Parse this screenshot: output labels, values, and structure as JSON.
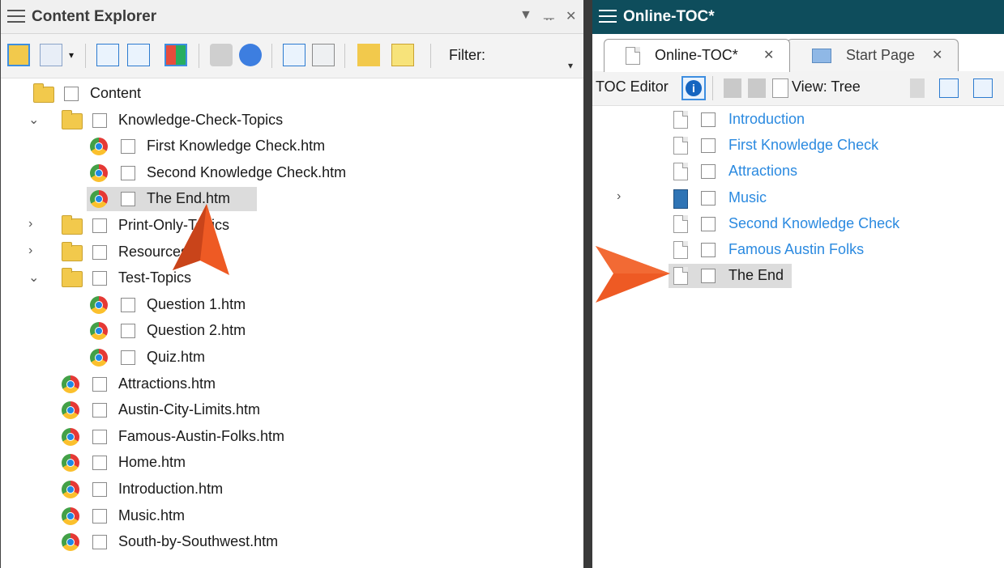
{
  "left": {
    "title": "Content Explorer",
    "window_controls": {
      "dropdown": "▼",
      "pin": "ᅲ",
      "close": "✕"
    },
    "filter_label": "Filter:",
    "tree": [
      {
        "label": "Content",
        "icon": "folder-open-icon",
        "level": 0,
        "chevron": ""
      },
      {
        "label": "Knowledge-Check-Topics",
        "icon": "folder-open-icon",
        "level": 1,
        "chevron": "⌄"
      },
      {
        "label": "First Knowledge Check.htm",
        "icon": "chrome-icon",
        "level": 2,
        "chevron": ""
      },
      {
        "label": "Second Knowledge Check.htm",
        "icon": "chrome-icon",
        "level": 2,
        "chevron": ""
      },
      {
        "label": "The End.htm",
        "icon": "chrome-icon",
        "level": 2,
        "chevron": "",
        "selected": true
      },
      {
        "label": "Print-Only-Topics",
        "icon": "folder-icon",
        "level": 1,
        "chevron": "›"
      },
      {
        "label": "Resources",
        "icon": "folder-icon",
        "level": 1,
        "chevron": "›"
      },
      {
        "label": "Test-Topics",
        "icon": "folder-open-icon",
        "level": 1,
        "chevron": "⌄"
      },
      {
        "label": "Question 1.htm",
        "icon": "chrome-icon",
        "level": 2,
        "chevron": ""
      },
      {
        "label": "Question 2.htm",
        "icon": "chrome-icon",
        "level": 2,
        "chevron": ""
      },
      {
        "label": "Quiz.htm",
        "icon": "chrome-icon",
        "level": 2,
        "chevron": ""
      },
      {
        "label": "Attractions.htm",
        "icon": "chrome-icon",
        "level": 1,
        "chevron": ""
      },
      {
        "label": "Austin-City-Limits.htm",
        "icon": "chrome-icon",
        "level": 1,
        "chevron": ""
      },
      {
        "label": "Famous-Austin-Folks.htm",
        "icon": "chrome-icon",
        "level": 1,
        "chevron": ""
      },
      {
        "label": "Home.htm",
        "icon": "chrome-icon",
        "level": 1,
        "chevron": ""
      },
      {
        "label": "Introduction.htm",
        "icon": "chrome-icon",
        "level": 1,
        "chevron": ""
      },
      {
        "label": "Music.htm",
        "icon": "chrome-icon",
        "level": 1,
        "chevron": ""
      },
      {
        "label": "South-by-Southwest.htm",
        "icon": "chrome-icon",
        "level": 1,
        "chevron": ""
      }
    ]
  },
  "right": {
    "title": "Online-TOC*",
    "tabs": [
      {
        "label": "Online-TOC*",
        "close": "✕",
        "active": true
      },
      {
        "label": "Start Page",
        "close": "✕",
        "active": false
      }
    ],
    "toolbar": {
      "editor_label": "TOC Editor",
      "view_label": "View: Tree"
    },
    "toc": [
      {
        "label": "Introduction",
        "icon": "page-icon",
        "link": true,
        "chevron": ""
      },
      {
        "label": "First Knowledge Check",
        "icon": "page-icon",
        "link": true,
        "chevron": ""
      },
      {
        "label": "Attractions",
        "icon": "page-icon",
        "link": true,
        "chevron": ""
      },
      {
        "label": "Music",
        "icon": "book-icon",
        "link": true,
        "chevron": "›"
      },
      {
        "label": "Second Knowledge Check",
        "icon": "page-icon",
        "link": true,
        "chevron": ""
      },
      {
        "label": "Famous Austin Folks",
        "icon": "page-icon",
        "link": true,
        "chevron": ""
      },
      {
        "label": "The End",
        "icon": "page-icon",
        "link": false,
        "chevron": "",
        "selected": true
      }
    ]
  },
  "colors": {
    "link": "#2b8ae0",
    "accent": "#ee5a24",
    "right_titlebar": "#0e4d5c",
    "selection": "#dcdcdc"
  }
}
